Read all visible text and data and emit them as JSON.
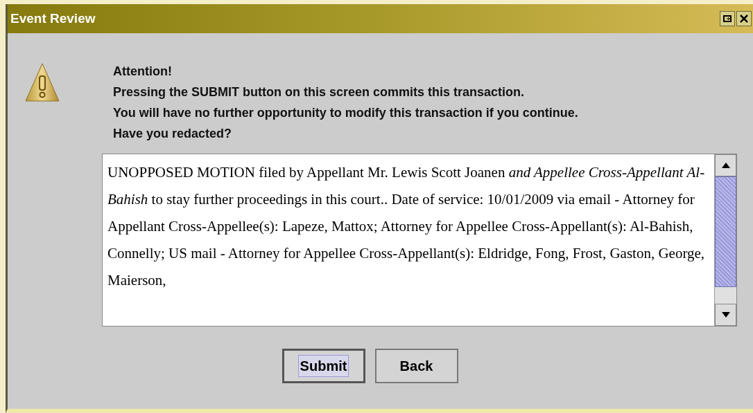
{
  "window": {
    "title": "Event Review"
  },
  "message": [
    "Attention!",
    "Pressing the SUBMIT button on this screen commits this transaction.",
    "You will have no further opportunity to modify this transaction if you continue.",
    "Have you redacted?"
  ],
  "docket_text": "UNOPPOSED MOTION filed by Appellant Mr. Lewis Scott Joanen *and Appellee Cross-Appellant Al-Bahish* to stay further proceedings in this court.. Date of service: 10/01/2009 via email - Attorney for Appellant Cross-Appellee(s): Lapeze, Mattox; Attorney for Appellee Cross-Appellant(s): Al-Bahish, Connelly; US mail - Attorney for Appellee Cross-Appellant(s): Eldridge, Fong, Frost, Gaston, George, Maierson,",
  "buttons": [
    {
      "label": "Submit",
      "focused": true
    },
    {
      "label": "Back",
      "focused": false
    }
  ]
}
